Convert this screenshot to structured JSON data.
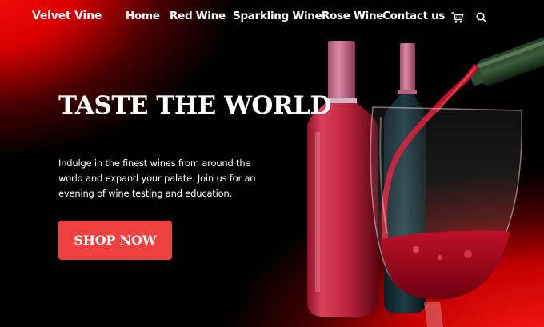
{
  "brand": {
    "name": "Velvet Vine"
  },
  "nav": {
    "items": [
      {
        "label": "Home"
      },
      {
        "label": "Red Wine"
      },
      {
        "label": "Sparkling Wine"
      },
      {
        "label": "Rose Wine"
      },
      {
        "label": "Contact us"
      }
    ],
    "icons": [
      "cart-icon",
      "search-icon"
    ]
  },
  "hero": {
    "headline": "TASTE THE WORLD",
    "description": "Indulge in the finest wines from around the world and expand your palate. Join us for an evening of wine testing and education.",
    "cta_label": "SHOP NOW",
    "image": "wine-bottles-and-glass"
  },
  "colors": {
    "accent": "#f04141",
    "background": "#000000",
    "glow": "#ff1a1a",
    "text": "#ffffff"
  }
}
